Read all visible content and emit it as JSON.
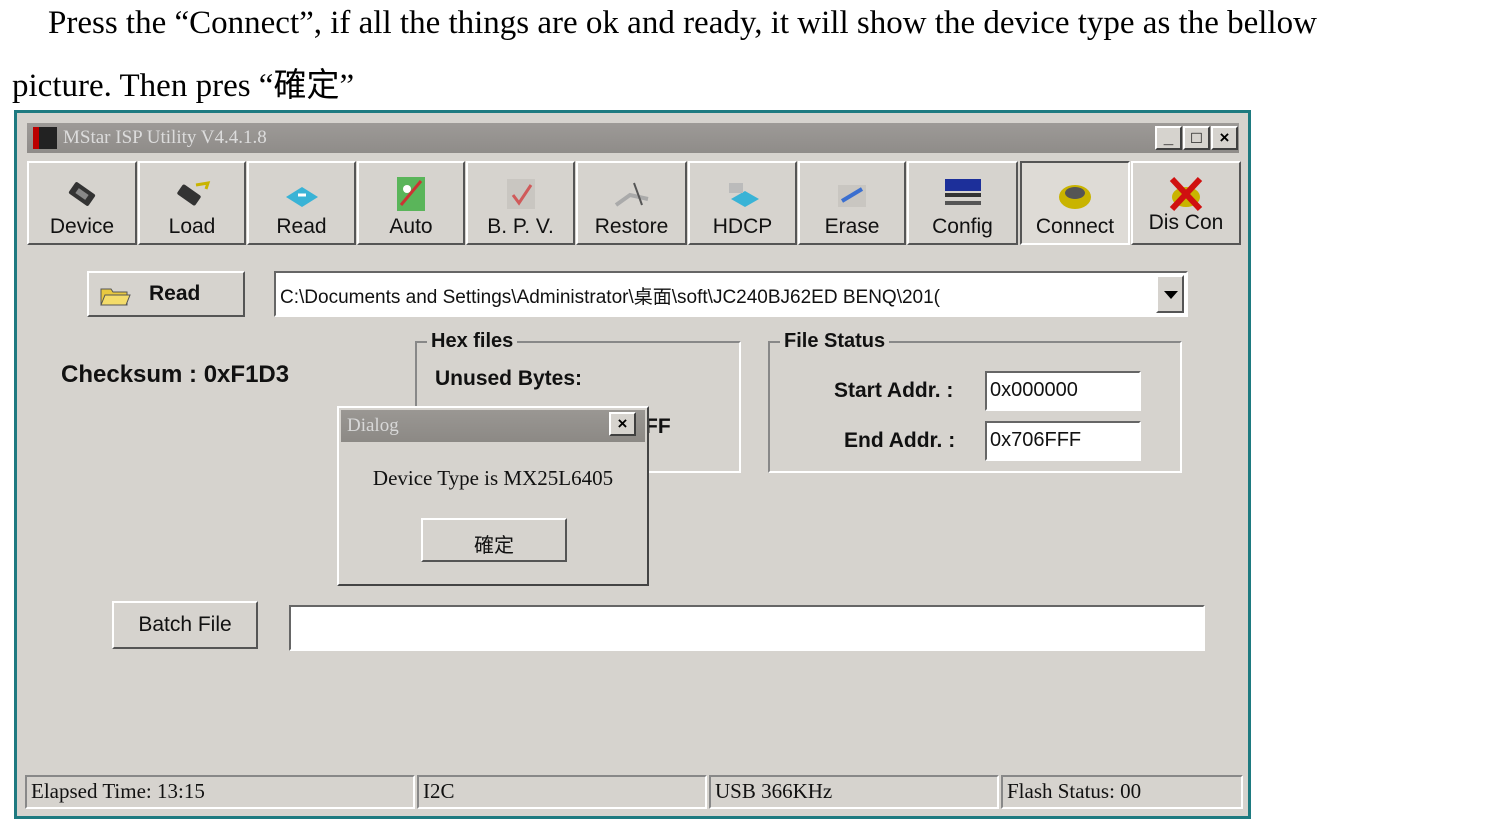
{
  "document": {
    "line1": "Press the “Connect”, if all the things are ok and ready, it will show the device type as the bellow",
    "line2": "picture. Then pres “確定”"
  },
  "window": {
    "title": "MStar ISP Utility V4.4.1.8",
    "controls": {
      "minimize": "_",
      "maximize": "□",
      "close": "×"
    }
  },
  "toolbar": {
    "items": [
      {
        "label": "Device",
        "icon": "device-chip-icon"
      },
      {
        "label": "Load",
        "icon": "load-chip-icon"
      },
      {
        "label": "Read",
        "icon": "read-icon"
      },
      {
        "label": "Auto",
        "icon": "auto-icon"
      },
      {
        "label": "B. P. V.",
        "icon": "bpv-icon"
      },
      {
        "label": "Restore",
        "icon": "restore-icon"
      },
      {
        "label": "HDCP",
        "icon": "hdcp-icon"
      },
      {
        "label": "Erase",
        "icon": "erase-icon"
      },
      {
        "label": "Config",
        "icon": "config-icon"
      },
      {
        "label": "Connect",
        "icon": "connect-icon"
      },
      {
        "label": "Dis Con",
        "icon": "disconnect-icon"
      }
    ]
  },
  "main": {
    "read_button": "Read",
    "file_path": "C:\\Documents and Settings\\Administrator\\桌面\\soft\\JC240BJ62ED BENQ\\201(",
    "checksum": "Checksum : 0xF1D3",
    "hex_files": {
      "title": "Hex files",
      "unused_bytes_label": "Unused Bytes:",
      "value_partial": "FF"
    },
    "file_status": {
      "title": "File Status",
      "start_label": "Start Addr. :",
      "start_value": "0x000000",
      "end_label": "End Addr. :",
      "end_value": "0x706FFF"
    },
    "batch_button": "Batch File",
    "batch_value": ""
  },
  "dialog": {
    "title": "Dialog",
    "close": "×",
    "message": "Device Type is MX25L6405",
    "ok_button": "確定"
  },
  "status_bar": {
    "elapsed": "Elapsed Time: 13:15",
    "bus": "I2C",
    "usb": "USB  366KHz",
    "flash": "Flash Status: 00"
  },
  "colors": {
    "window_border": "#1e7a80",
    "face": "#d6d3ce",
    "titlebar": "#8f8c89"
  }
}
